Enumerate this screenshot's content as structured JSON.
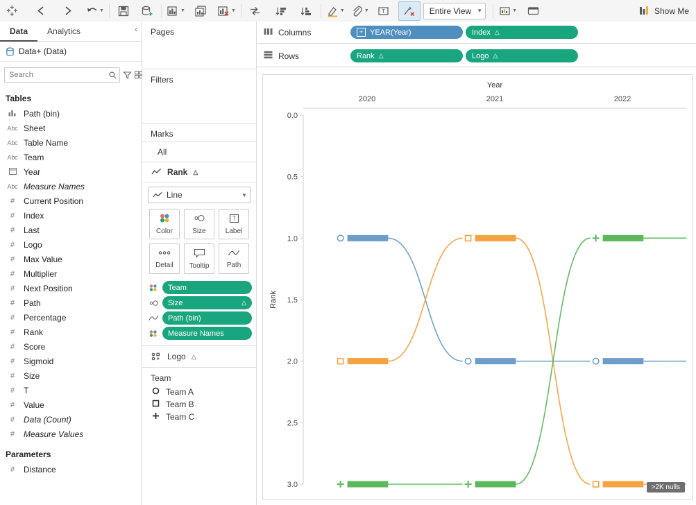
{
  "toolbar": {
    "logo_icon": "tableau-logo-icon",
    "buttons": [
      {
        "name": "back-button",
        "icon": "arrow-left-icon",
        "state": "enabled"
      },
      {
        "name": "forward-button",
        "icon": "arrow-right-icon",
        "state": "enabled"
      },
      {
        "name": "undo-button",
        "icon": "undo-icon",
        "state": "enabled",
        "has_caret": true
      },
      {
        "name": "save-button",
        "icon": "save-icon",
        "state": "enabled"
      },
      {
        "name": "new-data-source-button",
        "icon": "add-data-source-icon",
        "state": "enabled"
      },
      {
        "name": "new-worksheet-button",
        "icon": "new-worksheet-icon",
        "state": "enabled",
        "has_caret": true
      },
      {
        "name": "duplicate-sheet-button",
        "icon": "duplicate-sheet-icon",
        "state": "enabled"
      },
      {
        "name": "clear-sheet-button",
        "icon": "clear-sheet-icon",
        "state": "enabled",
        "has_caret": true
      },
      {
        "name": "swap-rows-columns-button",
        "icon": "swap-icon",
        "state": "enabled"
      },
      {
        "name": "sort-ascending-button",
        "icon": "sort-asc-icon",
        "state": "enabled"
      },
      {
        "name": "sort-descending-button",
        "icon": "sort-desc-icon",
        "state": "enabled"
      },
      {
        "name": "highlight-button",
        "icon": "highlighter-icon",
        "state": "enabled",
        "has_caret": true
      },
      {
        "name": "group-members-button",
        "icon": "paperclip-icon",
        "state": "enabled",
        "has_caret": true
      },
      {
        "name": "show-mark-labels-button",
        "icon": "label-icon",
        "state": "enabled"
      },
      {
        "name": "fix-axes-button",
        "icon": "fix-axes-icon",
        "state": "active"
      },
      {
        "name": "presentation-mode-button",
        "icon": "presentation-icon",
        "state": "enabled"
      }
    ],
    "fit_label": "Entire View",
    "fit_caret": "chevron-down-icon",
    "highlight_selected_button": {
      "name": "highlight-selected-items-button",
      "icon": "highlight-bar-icon",
      "has_caret": true
    },
    "show_me_label": "Show Me",
    "show_me_icon": "show-me-icon"
  },
  "left_pane": {
    "tabs": [
      {
        "label": "Data",
        "selected": true
      },
      {
        "label": "Analytics",
        "selected": false
      }
    ],
    "collapse_icon": "chevron-left-icon",
    "data_source": {
      "icon": "datasource-icon",
      "label": "Data+ (Data)"
    },
    "search": {
      "placeholder": "Search",
      "icon": "search-icon",
      "filter_icon": "filter-icon",
      "view_icon": "list-view-icon",
      "view_caret": "chevron-down-icon"
    },
    "tables_header": "Tables",
    "fields": [
      {
        "label": "Path (bin)",
        "type": "bin",
        "italic": false
      },
      {
        "label": "Sheet",
        "type": "abc",
        "italic": false
      },
      {
        "label": "Table Name",
        "type": "abc",
        "italic": false
      },
      {
        "label": "Team",
        "type": "abc",
        "italic": false
      },
      {
        "label": "Year",
        "type": "date",
        "italic": false
      },
      {
        "label": "Measure Names",
        "type": "abc",
        "italic": true
      },
      {
        "label": "Current Position",
        "type": "num",
        "italic": false
      },
      {
        "label": "Index",
        "type": "num",
        "italic": false
      },
      {
        "label": "Last",
        "type": "num",
        "italic": false
      },
      {
        "label": "Logo",
        "type": "num",
        "italic": false
      },
      {
        "label": "Max Value",
        "type": "num",
        "italic": false
      },
      {
        "label": "Multiplier",
        "type": "num",
        "italic": false
      },
      {
        "label": "Next Position",
        "type": "num",
        "italic": false
      },
      {
        "label": "Path",
        "type": "num",
        "italic": false
      },
      {
        "label": "Percentage",
        "type": "num",
        "italic": false
      },
      {
        "label": "Rank",
        "type": "num",
        "italic": false
      },
      {
        "label": "Score",
        "type": "num",
        "italic": false
      },
      {
        "label": "Sigmoid",
        "type": "num",
        "italic": false
      },
      {
        "label": "Size",
        "type": "num",
        "italic": false
      },
      {
        "label": "T",
        "type": "num",
        "italic": false
      },
      {
        "label": "Value",
        "type": "num",
        "italic": false
      },
      {
        "label": "Data (Count)",
        "type": "num",
        "italic": true
      },
      {
        "label": "Measure Values",
        "type": "num",
        "italic": true
      }
    ],
    "parameters_header": "Parameters",
    "parameters": [
      {
        "label": "Distance",
        "type": "num",
        "italic": false
      }
    ]
  },
  "cards": {
    "pages_title": "Pages",
    "filters_title": "Filters",
    "marks_title": "Marks",
    "marks_all_label": "All",
    "marks_rank_label": "Rank",
    "marks_rank_icon": "line-mark-icon",
    "marks_rank_caret": "triangle-icon",
    "mark_type_label": "Line",
    "mark_type_icon": "line-icon",
    "mark_type_caret": "chevron-down-icon",
    "buttons": [
      {
        "label": "Color",
        "icon": "color-icon"
      },
      {
        "label": "Size",
        "icon": "size-icon"
      },
      {
        "label": "Label",
        "icon": "label-icon"
      },
      {
        "label": "Detail",
        "icon": "detail-icon"
      },
      {
        "label": "Tooltip",
        "icon": "tooltip-icon"
      },
      {
        "label": "Path",
        "icon": "path-icon"
      }
    ],
    "encodings": [
      {
        "label": "Team",
        "icon": "color-icon",
        "color": "green",
        "has_caret": false
      },
      {
        "label": "Size",
        "icon": "size-icon",
        "color": "green",
        "has_caret": true
      },
      {
        "label": "Path (bin)",
        "icon": "path-icon",
        "color": "green",
        "has_caret": false
      },
      {
        "label": "Measure Names",
        "icon": "color-icon",
        "color": "green",
        "has_caret": false
      }
    ],
    "marks_logo_label": "Logo",
    "marks_logo_icon": "shape-mark-icon",
    "marks_logo_caret": "triangle-icon",
    "legend_title": "Team",
    "legend_items": [
      {
        "label": "Team A",
        "glyph": "○"
      },
      {
        "label": "Team B",
        "glyph": "◻"
      },
      {
        "label": "Team C",
        "glyph": "✛"
      }
    ]
  },
  "shelves": {
    "columns_label": "Columns",
    "columns_icon": "columns-icon",
    "columns_pills": [
      {
        "label": "YEAR(Year)",
        "color": "blue",
        "caret": false,
        "plusbox": true
      },
      {
        "label": "Index",
        "color": "green",
        "caret": true,
        "plusbox": false
      }
    ],
    "rows_label": "Rows",
    "rows_icon": "rows-icon",
    "rows_pills": [
      {
        "label": "Rank",
        "color": "green",
        "caret": true,
        "plusbox": false
      },
      {
        "label": "Logo",
        "color": "green",
        "caret": true,
        "plusbox": false
      }
    ]
  },
  "view": {
    "nulls_badge": ">2K nulls"
  },
  "chart_data": {
    "type": "line",
    "title": "Year",
    "xlabel": "Year",
    "ylabel": "Rank",
    "x_tick_labels": [
      "2020",
      "2021",
      "2022"
    ],
    "x_tick_values": [
      2020,
      2021,
      2022
    ],
    "y_tick_labels": [
      "0.0",
      "0.5",
      "1.0",
      "1.5",
      "2.0",
      "2.5",
      "3.0"
    ],
    "y_tick_values": [
      0.0,
      0.5,
      1.0,
      1.5,
      2.0,
      2.5,
      3.0
    ],
    "ylim": [
      0.0,
      3.0
    ],
    "y_inverted": true,
    "grid": false,
    "legend_position": "left-panel",
    "series": [
      {
        "name": "Team A",
        "shape": "circle",
        "color": "#6d9ec9",
        "points": [
          {
            "x": 2020,
            "rank": 1
          },
          {
            "x": 2021,
            "rank": 2
          },
          {
            "x": 2022,
            "rank": 2
          }
        ]
      },
      {
        "name": "Team B",
        "shape": "square",
        "color": "#f5a341",
        "points": [
          {
            "x": 2020,
            "rank": 2
          },
          {
            "x": 2021,
            "rank": 1
          },
          {
            "x": 2022,
            "rank": 3
          }
        ]
      },
      {
        "name": "Team C",
        "shape": "plus",
        "color": "#5bb85b",
        "points": [
          {
            "x": 2020,
            "rank": 3
          },
          {
            "x": 2021,
            "rank": 3
          },
          {
            "x": 2022,
            "rank": 1
          }
        ]
      }
    ]
  }
}
